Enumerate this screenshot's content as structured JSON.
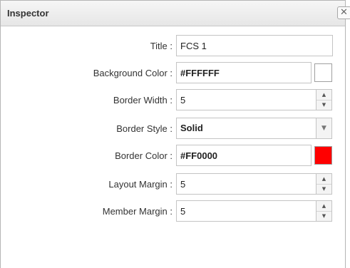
{
  "window": {
    "title": "Inspector",
    "close_icon": "✕"
  },
  "fields": {
    "title": {
      "label": "Title :",
      "value": "FCS 1"
    },
    "background_color": {
      "label": "Background Color :",
      "value": "#FFFFFF",
      "swatch": "#FFFFFF"
    },
    "border_width": {
      "label": "Border Width :",
      "value": "5"
    },
    "border_style": {
      "label": "Border Style :",
      "value": "Solid"
    },
    "border_color": {
      "label": "Border Color :",
      "value": "#FF0000",
      "swatch": "#FF0000"
    },
    "layout_margin": {
      "label": "Layout Margin :",
      "value": "5"
    },
    "member_margin": {
      "label": "Member Margin :",
      "value": "5"
    }
  },
  "icons": {
    "spin_up": "▲",
    "spin_down": "▼",
    "dropdown": "▼"
  }
}
